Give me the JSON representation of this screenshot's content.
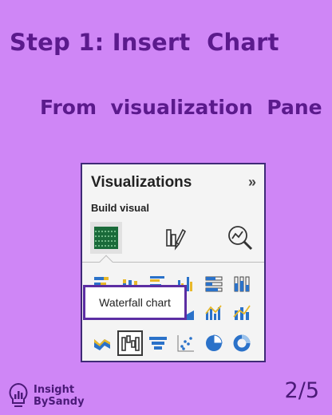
{
  "header": {
    "title": "Step 1: Insert  Chart",
    "subtitle": "From  visualization  Pane"
  },
  "pane": {
    "title": "Visualizations",
    "collapse_glyph": "»",
    "build_visual_label": "Build visual",
    "build_icons": [
      "build-visual-icon",
      "format-visual-icon",
      "analytics-icon"
    ],
    "visual_icons": [
      [
        "stacked-bar-icon",
        "stacked-column-icon",
        "clustered-bar-icon",
        "clustered-column-icon",
        "100-stacked-bar-icon",
        "100-stacked-column-icon"
      ],
      [
        "line-chart-icon",
        "area-chart-icon",
        "stacked-area-icon",
        "line-column-icon",
        "ribbon-chart-icon",
        "line-stacked-column-icon"
      ],
      [
        "ribbon-icon",
        "waterfall-chart-icon",
        "funnel-icon",
        "scatter-icon",
        "pie-icon",
        "donut-icon"
      ]
    ],
    "tooltip": "Waterfall chart",
    "accent": "#5c2ea3"
  },
  "brand": {
    "line1": "Insight",
    "line2": "BySandy"
  },
  "page_indicator": "2/5",
  "colors": {
    "background": "#cf86f6",
    "heading": "#5b1a8c",
    "chart_yellow": "#e8b82a",
    "chart_blue": "#2b72c9"
  }
}
